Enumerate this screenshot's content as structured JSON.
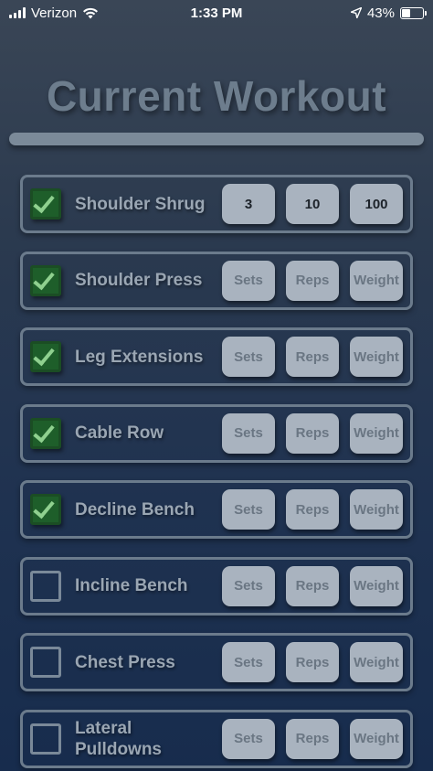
{
  "status_bar": {
    "carrier": "Verizon",
    "time": "1:33 PM",
    "battery": "43%",
    "battery_level": 0.43
  },
  "page_title": "Current Workout",
  "exercises": [
    {
      "name": "Shoulder Shrug",
      "checked": true,
      "sets": "3",
      "reps": "10",
      "weight": "100"
    },
    {
      "name": "Shoulder Press",
      "checked": true,
      "sets": "",
      "reps": "",
      "weight": ""
    },
    {
      "name": "Leg Extensions",
      "checked": true,
      "sets": "",
      "reps": "",
      "weight": ""
    },
    {
      "name": "Cable Row",
      "checked": true,
      "sets": "",
      "reps": "",
      "weight": ""
    },
    {
      "name": "Decline Bench",
      "checked": true,
      "sets": "",
      "reps": "",
      "weight": ""
    },
    {
      "name": "Incline Bench",
      "checked": false,
      "sets": "",
      "reps": "",
      "weight": ""
    },
    {
      "name": "Chest Press",
      "checked": false,
      "sets": "",
      "reps": "",
      "weight": ""
    },
    {
      "name": "Lateral Pulldowns",
      "checked": false,
      "sets": "",
      "reps": "",
      "weight": ""
    }
  ],
  "placeholders": {
    "sets": "Sets",
    "reps": "Reps",
    "weight": "Weight"
  },
  "colors": {
    "checked_fill": "#1e5e2a",
    "field_bg": "#a9b3bf",
    "title": "#6d7d8d"
  }
}
